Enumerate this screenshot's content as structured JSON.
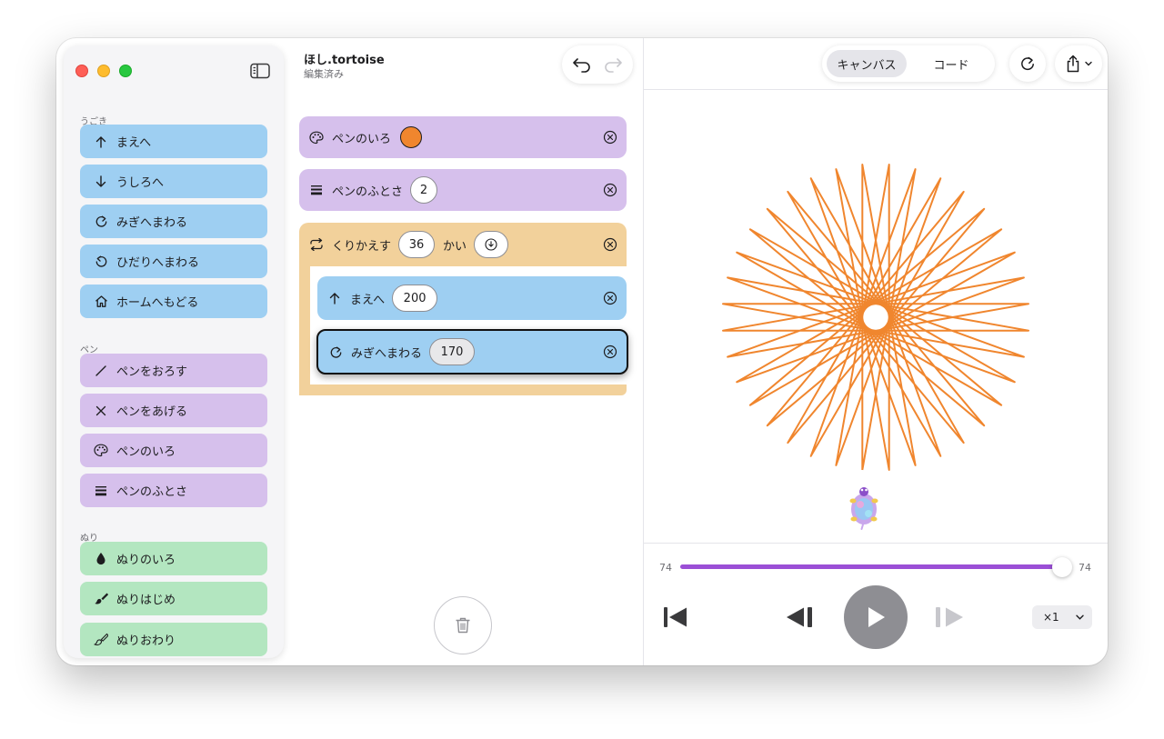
{
  "sidebar": {
    "sections": {
      "movement": "うごき",
      "pen": "ペン",
      "fill": "ぬり"
    },
    "movement_items": [
      {
        "label": "まえへ",
        "icon": "arrow-up-icon"
      },
      {
        "label": "うしろへ",
        "icon": "arrow-down-icon"
      },
      {
        "label": "みぎへまわる",
        "icon": "rotate-right-icon"
      },
      {
        "label": "ひだりへまわる",
        "icon": "rotate-left-icon"
      },
      {
        "label": "ホームへもどる",
        "icon": "home-icon"
      }
    ],
    "pen_items": [
      {
        "label": "ペンをおろす",
        "icon": "pen-down-icon"
      },
      {
        "label": "ペンをあげる",
        "icon": "pen-up-icon"
      },
      {
        "label": "ペンのいろ",
        "icon": "palette-icon"
      },
      {
        "label": "ペンのふとさ",
        "icon": "line-weight-icon"
      }
    ],
    "fill_items": [
      {
        "label": "ぬりのいろ",
        "icon": "drop-icon"
      },
      {
        "label": "ぬりはじめ",
        "icon": "paint-brush-icon"
      },
      {
        "label": "ぬりおわり",
        "icon": "paint-brush-outline-icon"
      }
    ]
  },
  "document": {
    "title": "ほし.tortoise",
    "status": "編集済み"
  },
  "program": {
    "pen_color": {
      "label": "ペンのいろ",
      "color": "#f0862e"
    },
    "pen_width": {
      "label": "ペンのふとさ",
      "value": "2"
    },
    "repeat": {
      "label": "くりかえす",
      "count": "36",
      "suffix": "かい"
    },
    "forward": {
      "label": "まえへ",
      "value": "200"
    },
    "turn_right": {
      "label": "みぎへまわる",
      "value": "170"
    }
  },
  "toolbar": {
    "canvas_tab": "キャンバス",
    "code_tab": "コード"
  },
  "playback": {
    "step_start": "74",
    "step_end": "74",
    "progress": 1.0,
    "speed": "×1"
  },
  "colors": {
    "movement": "#9ecff2",
    "pen": "#d6c0ec",
    "fill": "#b3e6c0",
    "repeat": "#f2d19b",
    "stroke": "#f0862e",
    "progress": "#9b4fd6"
  }
}
